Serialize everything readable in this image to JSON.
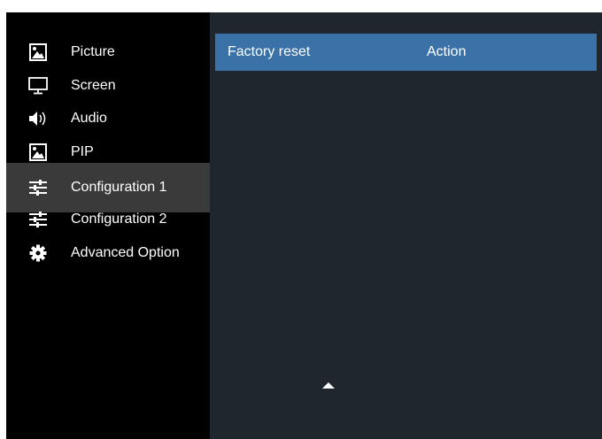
{
  "sidebar": {
    "items": [
      {
        "label": "Picture",
        "icon": "picture-icon"
      },
      {
        "label": "Screen",
        "icon": "monitor-icon"
      },
      {
        "label": "Audio",
        "icon": "speaker-icon"
      },
      {
        "label": "PIP",
        "icon": "pip-icon"
      },
      {
        "label": "Configuration 1",
        "icon": "sliders-icon",
        "selected": true
      },
      {
        "label": "Configuration 2",
        "icon": "sliders-icon"
      },
      {
        "label": "Advanced Option",
        "icon": "gear-icon"
      }
    ]
  },
  "content": {
    "rows": [
      {
        "label": "Factory reset",
        "value": "Action"
      }
    ]
  },
  "colors": {
    "sidebar_bg": "#000000",
    "selected_bg": "#3a3a3a",
    "content_bg": "#1f262e",
    "highlight_row": "#3a72a8",
    "text": "#ffffff"
  }
}
